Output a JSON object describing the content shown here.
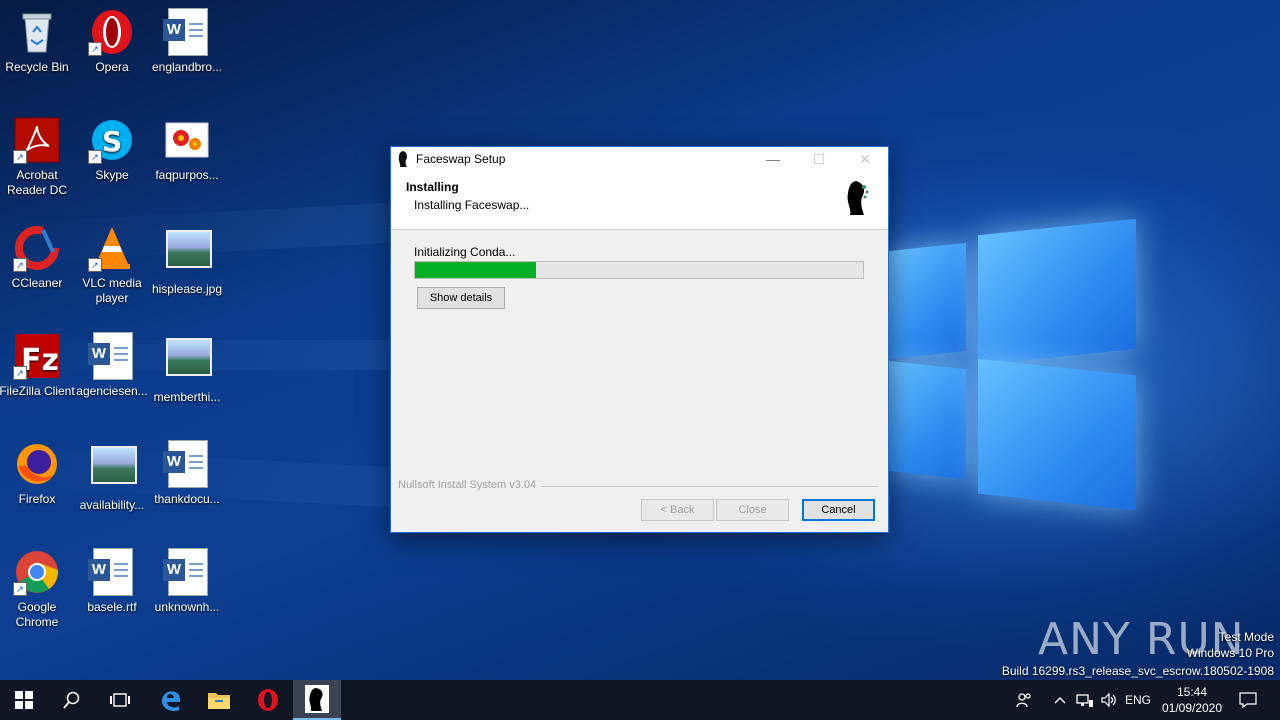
{
  "desktop_icons": [
    {
      "label": "Recycle Bin",
      "icon": "recycle-bin-icon"
    },
    {
      "label": "Opera",
      "icon": "opera-icon"
    },
    {
      "label": "englandbro...",
      "icon": "word-document-icon"
    },
    {
      "label": "Acrobat Reader DC",
      "icon": "acrobat-reader-icon"
    },
    {
      "label": "Skype",
      "icon": "skype-icon"
    },
    {
      "label": "faqpurpos...",
      "icon": "image-file-icon"
    },
    {
      "label": "CCleaner",
      "icon": "ccleaner-icon"
    },
    {
      "label": "VLC media player",
      "icon": "vlc-icon"
    },
    {
      "label": "hisplease.jpg",
      "icon": "image-file-icon"
    },
    {
      "label": "FileZilla Client",
      "icon": "filezilla-icon"
    },
    {
      "label": "agenciesen...",
      "icon": "word-document-icon"
    },
    {
      "label": "memberthi...",
      "icon": "image-file-icon"
    },
    {
      "label": "Firefox",
      "icon": "firefox-icon"
    },
    {
      "label": "availability...",
      "icon": "image-file-icon"
    },
    {
      "label": "thankdocu...",
      "icon": "word-document-icon"
    },
    {
      "label": "Google Chrome",
      "icon": "chrome-icon"
    },
    {
      "label": "basele.rtf",
      "icon": "word-document-icon"
    },
    {
      "label": "unknownh...",
      "icon": "word-document-icon"
    }
  ],
  "dialog": {
    "title": "Faceswap Setup",
    "header_title": "Installing",
    "header_subtitle": "Installing Faceswap...",
    "status_text": "Initializing Conda...",
    "progress_fraction": 0.27,
    "show_details_label": "Show details",
    "branding": "Nullsoft Install System v3.04",
    "back_label": "< Back",
    "close_label": "Close",
    "cancel_label": "Cancel"
  },
  "watermark": {
    "logo_text": "ANY RUN",
    "test_mode": "Test Mode",
    "edition": "Windows 10 Pro",
    "build": "Build 16299.rs3_release_svc_escrow.180502-1908"
  },
  "taskbar": {
    "language": "ENG",
    "time": "15:44",
    "date": "01/09/2020"
  },
  "colors": {
    "progress_fill": "#06b025",
    "accent": "#0078d7",
    "taskbar": "#0f1724"
  }
}
